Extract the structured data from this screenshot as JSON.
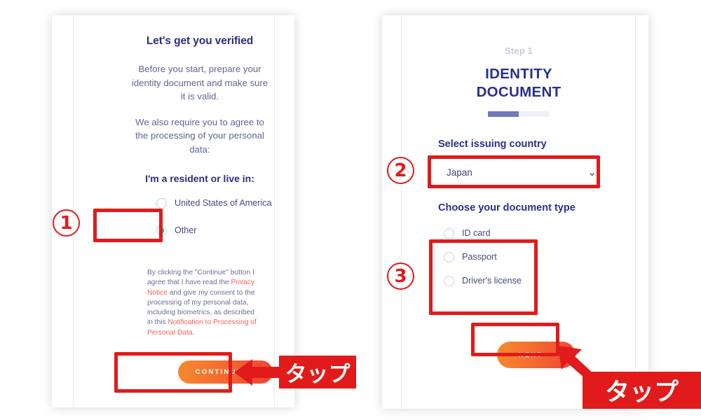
{
  "left_panel": {
    "title": "Let's get you verified",
    "intro_1": "Before you start, prepare your identity document and make sure it is valid.",
    "intro_2": "We also require you to agree to the processing of your personal data:",
    "residency_heading": "I'm a resident or live in:",
    "residency_options": [
      {
        "label": "United States of America",
        "selected": false
      },
      {
        "label": "Other",
        "selected": true
      }
    ],
    "legal": {
      "part_1": "By clicking the \"Continue\" button I agree that I have read the ",
      "link_1": "Privacy Notice",
      "part_2": " and give my consent to the processing of my personal data, including biometrics, as described in this ",
      "link_2": "Notification to Processing of Personal Data",
      "part_3": "."
    },
    "continue_button": "CONTINUE",
    "continue_chevron": ">"
  },
  "right_panel": {
    "step_label": "Step 1",
    "step_title_line_1": "IDENTITY",
    "step_title_line_2": "DOCUMENT",
    "progress_percent": 50,
    "country_heading": "Select issuing country",
    "country_value": "Japan",
    "country_chevron": "⌄",
    "doctype_heading": "Choose your document type",
    "doctype_options": [
      {
        "label": "ID card",
        "selected": false
      },
      {
        "label": "Passport",
        "selected": false
      },
      {
        "label": "Driver's license",
        "selected": false
      }
    ],
    "next_button": "NEXT",
    "next_chevron": ">"
  },
  "annotations": {
    "markers": [
      {
        "number": "①",
        "glyph": "1"
      },
      {
        "number": "②",
        "glyph": "2"
      },
      {
        "number": "③",
        "glyph": "3"
      }
    ],
    "tap_label_left": "タップ",
    "tap_label_right": "タップ"
  },
  "colors": {
    "annotation_red": "#e11b1b",
    "brand_navy": "#28318c",
    "body_blue": "#5f6794",
    "link_salmon": "#f4635a",
    "radio_teal": "#17c8a6",
    "progress_fill": "#7179b8",
    "progress_track": "#eef0f7",
    "button_gradient_from": "#f68a2e",
    "button_gradient_to": "#ef4136"
  }
}
